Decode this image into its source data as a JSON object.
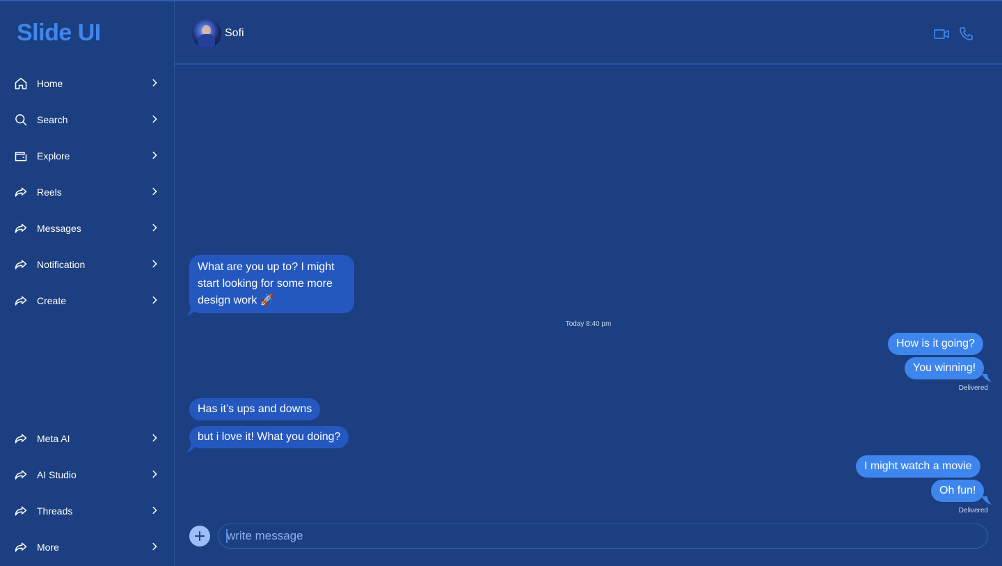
{
  "app": {
    "logo": "Slide UI"
  },
  "colors": {
    "background": "#1b3f80",
    "accent": "#3e86ee",
    "incoming_bubble": "#2458bf",
    "outgoing_bubble": "#3e86ee"
  },
  "sidebar": {
    "items": [
      {
        "label": "Home",
        "icon": "home-icon"
      },
      {
        "label": "Search",
        "icon": "search-icon"
      },
      {
        "label": "Explore",
        "icon": "wallet-icon"
      },
      {
        "label": "Reels",
        "icon": "share-arrow-icon"
      },
      {
        "label": "Messages",
        "icon": "share-arrow-icon"
      },
      {
        "label": "Notification",
        "icon": "share-arrow-icon"
      },
      {
        "label": "Create",
        "icon": "share-arrow-icon"
      }
    ],
    "bottom_items": [
      {
        "label": "Meta AI",
        "icon": "share-arrow-icon"
      },
      {
        "label": "AI Studio",
        "icon": "share-arrow-icon"
      },
      {
        "label": "Threads",
        "icon": "share-arrow-icon"
      },
      {
        "label": "More",
        "icon": "share-arrow-icon"
      }
    ]
  },
  "chat": {
    "contact_name": "Sofi",
    "header_icons": [
      "video-camera-icon",
      "phone-icon"
    ],
    "messages": [
      {
        "direction": "in",
        "text": "What are you up to? I might start looking for some more design work 🚀"
      },
      {
        "timestamp": "Today 8:40 pm"
      },
      {
        "direction": "out",
        "text": "How is it going?"
      },
      {
        "direction": "out",
        "text": "You winning!"
      },
      {
        "status": "Delivered"
      },
      {
        "direction": "in",
        "text": "Has it’s ups and downs"
      },
      {
        "direction": "in",
        "text": "but i love it! What you doing?"
      },
      {
        "direction": "out",
        "text": "I might watch a movie"
      },
      {
        "direction": "out",
        "text": "Oh fun!"
      },
      {
        "status": "Delivered"
      }
    ],
    "composer": {
      "placeholder": "write message",
      "value": ""
    }
  }
}
